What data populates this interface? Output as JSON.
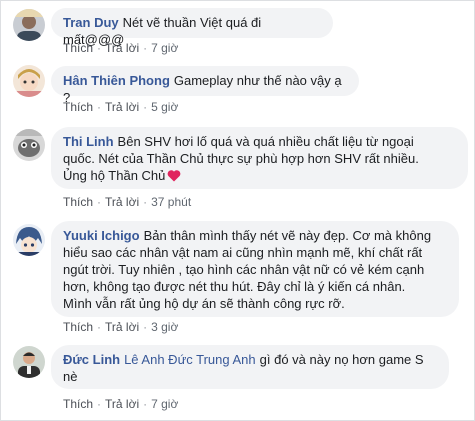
{
  "comments": [
    {
      "name": "Tran Duy",
      "text": "Nét vẽ thuần Việt quá đi mất@@@",
      "like_label": "Thích",
      "reply_label": "Trả lời",
      "time": "7 giờ"
    },
    {
      "name": "Hân Thiên Phong",
      "text": "Gameplay như thế nào vậy ạ ?",
      "like_label": "Thích",
      "reply_label": "Trả lời",
      "time": "5 giờ"
    },
    {
      "name": "Thi Linh",
      "lines": [
        "Bên SHV hơi lố quá và quá nhiều chất liệu từ ngoại",
        "quốc. Nét của Thần Chủ thực sự phù hợp hơn SHV rất nhiều.",
        "Ủng hộ Thần Chủ"
      ],
      "like_label": "Thích",
      "reply_label": "Trả lời",
      "time": "37 phút",
      "emoji": "red-heart"
    },
    {
      "name": "Yuuki Ichigo",
      "lines": [
        "Bản thân mình thấy nét vẽ này đẹp. Cơ mà không",
        "hiểu sao các nhân vật nam ai cũng nhìn mạnh mẽ, khí chất rất",
        "ngút trời. Tuy nhiên , tạo hình các nhân vật nữ có vẻ kém cạnh",
        "hơn, không tạo được nét thu hút. Đây chỉ là ý kiến cá nhân.",
        "Mình vẫn rất ủng hộ dự án sẽ thành công rực rỡ."
      ],
      "like_label": "Thích",
      "reply_label": "Trả lời",
      "time": "3 giờ"
    },
    {
      "name": "Đức Linh",
      "mention": "Lê Anh Đức Trung Anh",
      "text_after_mention": "gì đó và này nọ hơn game S",
      "text_line2": "nè",
      "like_label": "Thích",
      "reply_label": "Trả lời",
      "time": "7 giờ"
    }
  ],
  "colors": {
    "name": "#385898",
    "bubble": "#f2f3f5",
    "meta": "#606770",
    "heart": "#e0245e"
  }
}
